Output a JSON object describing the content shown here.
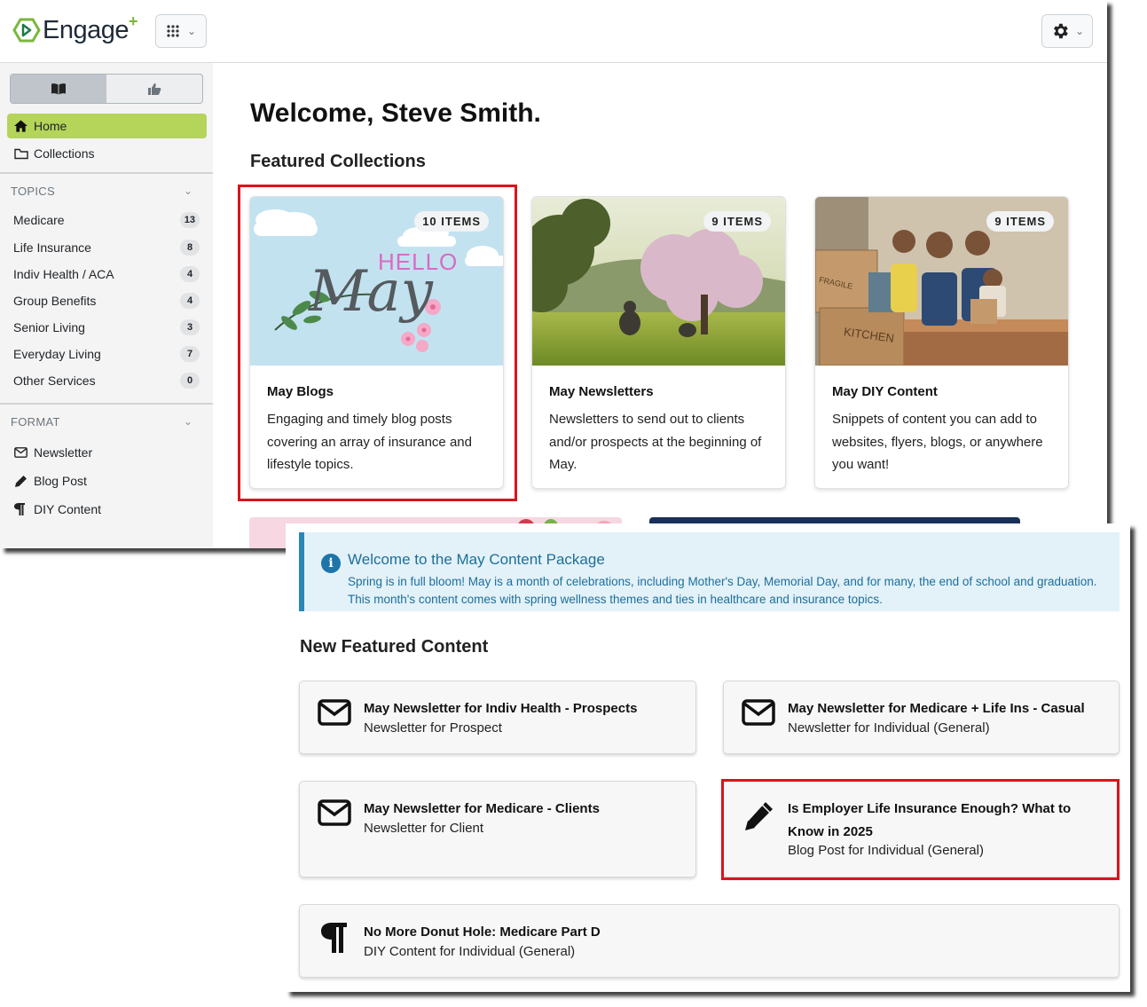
{
  "header": {
    "logo_text": "Engage",
    "logo_plus": "+"
  },
  "sidebar": {
    "nav": [
      {
        "label": "Home",
        "icon": "home-icon"
      },
      {
        "label": "Collections",
        "icon": "folder-icon"
      }
    ],
    "topics_label": "TOPICS",
    "topics": [
      {
        "label": "Medicare",
        "count": "13"
      },
      {
        "label": "Life Insurance",
        "count": "8"
      },
      {
        "label": "Indiv Health / ACA",
        "count": "4"
      },
      {
        "label": "Group Benefits",
        "count": "4"
      },
      {
        "label": "Senior Living",
        "count": "3"
      },
      {
        "label": "Everyday Living",
        "count": "7"
      },
      {
        "label": "Other Services",
        "count": "0"
      }
    ],
    "format_label": "FORMAT",
    "formats": [
      {
        "label": "Newsletter",
        "icon": "envelope-icon"
      },
      {
        "label": "Blog Post",
        "icon": "pencil-icon"
      },
      {
        "label": "DIY Content",
        "icon": "paragraph-icon"
      }
    ]
  },
  "main": {
    "welcome": "Welcome, Steve Smith.",
    "featured_title": "Featured Collections",
    "collections": [
      {
        "items": "10 ITEMS",
        "title": "May Blogs",
        "desc": "Engaging and timely blog posts covering an array of insurance and lifestyle topics.",
        "hello": "HELLO",
        "may": "May"
      },
      {
        "items": "9 ITEMS",
        "title": "May Newsletters",
        "desc": "Newsletters to send out to clients and/or prospects at the beginning of May."
      },
      {
        "items": "9 ITEMS",
        "title": "May DIY Content",
        "desc": "Snippets of content you can add to websites, flyers, blogs, or anywhere you want!",
        "fragile": "FRAGILE",
        "kitchen": "KITCHEN"
      }
    ]
  },
  "info_alert": {
    "title": "Welcome to the May Content Package",
    "body": "Spring is in full bloom! May is a month of celebrations, including Mother's Day, Memorial Day, and for many, the end of school and graduation. This month's content comes with spring wellness themes and ties in healthcare and insurance topics."
  },
  "new_featured": {
    "title": "New Featured Content",
    "items": [
      {
        "title": "May Newsletter for Indiv Health - Prospects",
        "sub": "Newsletter for Prospect",
        "icon": "envelope-icon"
      },
      {
        "title": "May Newsletter for Medicare + Life Ins - Casual",
        "sub": "Newsletter for Individual (General)",
        "icon": "envelope-icon"
      },
      {
        "title": "May Newsletter for Medicare - Clients",
        "sub": "Newsletter for Client",
        "icon": "envelope-icon"
      },
      {
        "title": "Is Employer Life Insurance Enough? What to Know in 2025",
        "sub": "Blog Post for Individual (General)",
        "icon": "pencil-icon"
      },
      {
        "title": "No More Donut Hole: Medicare Part D",
        "sub": "DIY Content for Individual (General)",
        "icon": "paragraph-icon"
      }
    ]
  },
  "colors": {
    "accent_green": "#b5d45a",
    "highlight_red": "#d9141c",
    "info_blue": "#1d6f99"
  }
}
